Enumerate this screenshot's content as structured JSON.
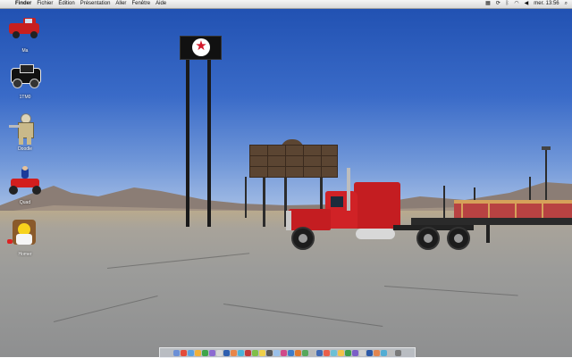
{
  "menubar": {
    "apple_symbol": "",
    "items": [
      {
        "label": "Finder",
        "active": true
      },
      {
        "label": "Fichier"
      },
      {
        "label": "Édition"
      },
      {
        "label": "Présentation"
      },
      {
        "label": "Aller"
      },
      {
        "label": "Fenêtre"
      },
      {
        "label": "Aide"
      }
    ],
    "status_icons": [
      "spaces-icon",
      "sync-icon",
      "bluetooth-icon",
      "wifi-icon",
      "volume-icon"
    ],
    "clock": "mer. 13:56",
    "spotlight_icon": "search-icon"
  },
  "desktop_icons": [
    {
      "label": "Ma",
      "icon": "red-pickup-truck-icon"
    },
    {
      "label": "1TM0",
      "icon": "black-car-icon"
    },
    {
      "label": "Doodle",
      "icon": "stormtrooper-figure-icon"
    },
    {
      "label": "Quad",
      "icon": "atv-rider-icon"
    },
    {
      "label": "Homer",
      "icon": "homer-simpson-icon"
    }
  ],
  "dock": {
    "item_count": 32,
    "colors": [
      "#6b8fd6",
      "#e34b3a",
      "#5aa0e0",
      "#f1b13a",
      "#3fa54a",
      "#8c6ad1",
      "#d5d5d5",
      "#2f5fb0",
      "#e8864a",
      "#4bb3d9",
      "#c43c3c",
      "#7fbf4a",
      "#f0d04a",
      "#5a5a5a",
      "#9ac0ea",
      "#d04a8a",
      "#3e7cc9",
      "#e07a2f",
      "#57a85c",
      "#b9b9b9",
      "#416ab5",
      "#ea5f4b",
      "#6dc0d5",
      "#f3c24a",
      "#3f9e4d",
      "#7b5ec7",
      "#cfcfcf",
      "#2d5aa8",
      "#e28650",
      "#52add4",
      "#bcbcbc",
      "#7a7a7a"
    ]
  },
  "wallpaper": {
    "subject": "red-semi-truck-desert-gas-station"
  }
}
